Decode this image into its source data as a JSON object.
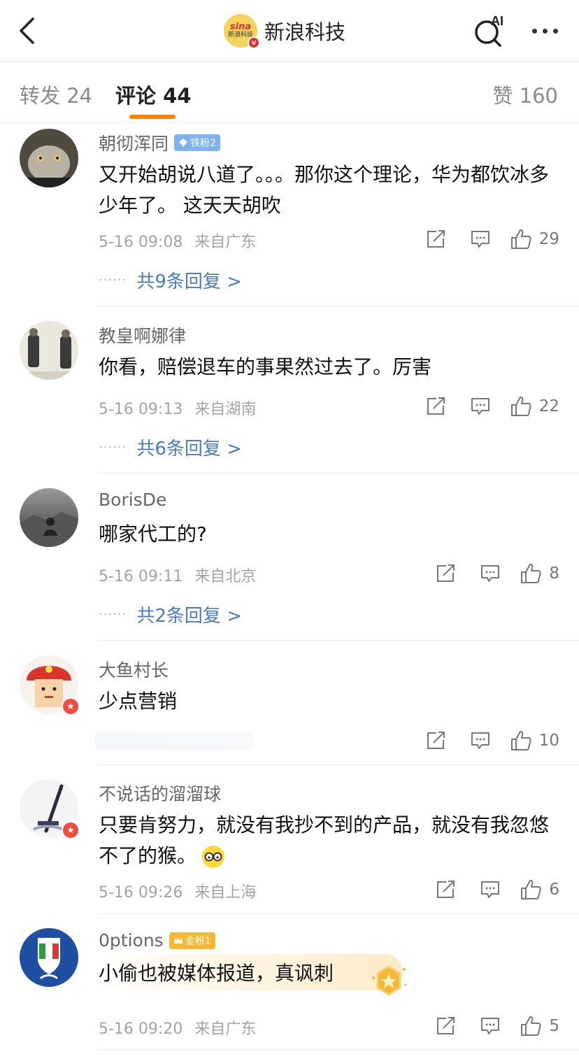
{
  "header": {
    "brand_logo_line1": "sina",
    "brand_logo_line2": "新浪科技",
    "title": "新浪科技",
    "ai_label": "AI"
  },
  "tabs": {
    "repost": "转发 24",
    "comments": "评论 44",
    "likes": "赞 160"
  },
  "comments": [
    {
      "user": "朝彻浑同",
      "badge": "铁粉2",
      "text": "又开始胡说八道了。。。那你这个理论，华为都饮冰多少年了。 这天天胡吹",
      "time": "5-16 09:08",
      "location": "来自广东",
      "likes": "29",
      "replies": "共9条回复 >"
    },
    {
      "user": "教皇啊娜律",
      "text": "你看，赔偿退车的事果然过去了。厉害",
      "time": "5-16 09:13",
      "location": "来自湖南",
      "likes": "22",
      "replies": "共6条回复 >"
    },
    {
      "user": "BorisDe",
      "text": "哪家代工的?",
      "time": "5-16 09:11",
      "location": "来自北京",
      "likes": "8",
      "replies": "共2条回复 >"
    },
    {
      "user": "大鱼村长",
      "text": "少点营销",
      "likes": "10"
    },
    {
      "user": "不说话的溜溜球",
      "text": "只要肯努力，就没有我抄不到的产品，就没有我忽悠不了的猴。",
      "time": "5-16 09:26",
      "location": "来自上海",
      "likes": "6"
    },
    {
      "user": "0ptions",
      "badge": "金粉1",
      "text": "小偷也被媒体报道，真讽刺",
      "time": "5-16 09:20",
      "location": "来自广东",
      "likes": "5"
    }
  ],
  "colors": {
    "accent": "#ff8200",
    "link": "#4a7db8",
    "muted": "#a3a3a3"
  }
}
